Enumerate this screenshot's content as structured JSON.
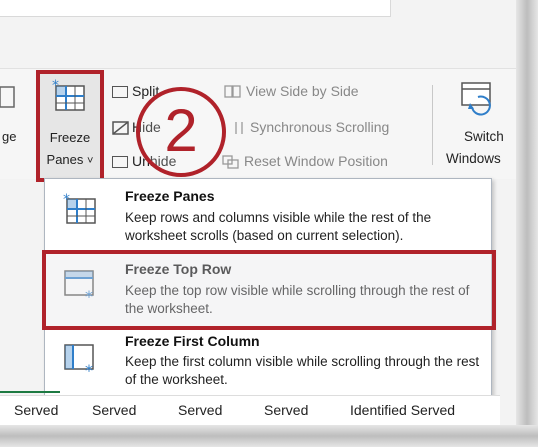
{
  "ribbon": {
    "freeze_label_1": "Freeze",
    "freeze_label_2": "Panes",
    "chevron": "˅",
    "left_cut_text": "ge",
    "split": "Split",
    "hide": "Hide",
    "unhide": "Unhide",
    "view_side_by_side": "View Side by Side",
    "synchronous_scrolling": "Synchronous Scrolling",
    "reset_window_position": "Reset Window Position",
    "switch_1": "Switch",
    "switch_2": "Windows"
  },
  "step": {
    "number": "2"
  },
  "menu": {
    "items": [
      {
        "title": "Freeze Panes",
        "description": "Keep rows and columns visible while the rest of the worksheet scrolls (based on current selection).",
        "icon": "freeze-panes-icon"
      },
      {
        "title": "Freeze Top Row",
        "description": "Keep the top row visible while scrolling through the rest of the worksheet.",
        "icon": "freeze-top-row-icon"
      },
      {
        "title": "Freeze First Column",
        "description": "Keep the first column visible while scrolling through the rest of the worksheet.",
        "icon": "freeze-first-column-icon"
      }
    ]
  },
  "sheet": {
    "cells": [
      "Served",
      "Served",
      "Served",
      "Served",
      "Identified Served"
    ]
  },
  "colors": {
    "accent_red": "#b0222a",
    "icon_blue": "#2f7ec9",
    "excel_green": "#1d7a42"
  }
}
